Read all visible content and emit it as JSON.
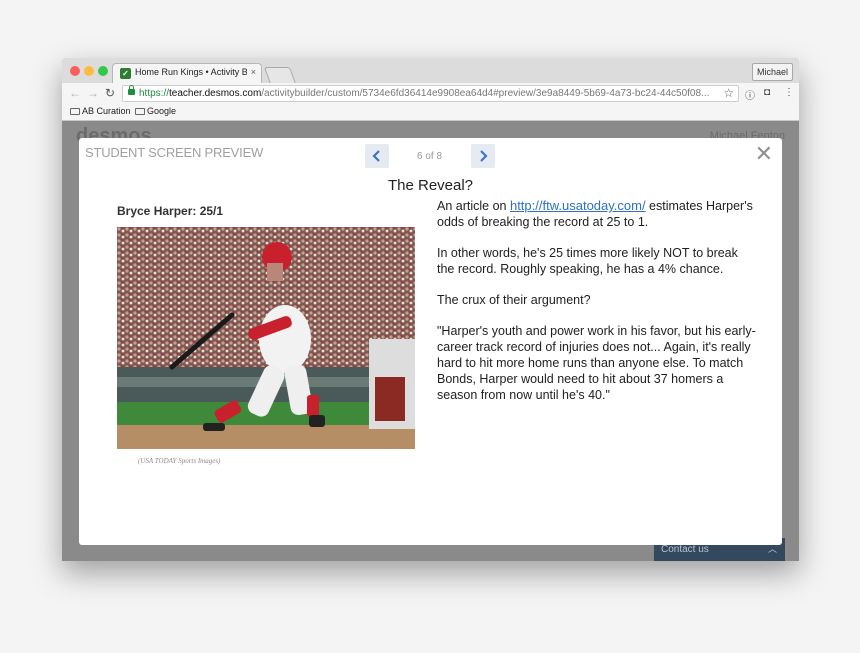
{
  "browser": {
    "tab_title": "Home Run Kings • Activity Buil",
    "tab_close_glyph": "×",
    "profile_label": "Michael",
    "url_scheme": "https://",
    "url_host": "teacher.desmos.com",
    "url_path": "/activitybuilder/custom/5734e6fd36414e9908ea64d4#preview/3e9a8449-5b69-4a73-bc24-44c50f08...",
    "bookmarks": [
      {
        "label": "AB Curation"
      },
      {
        "label": "Google"
      }
    ]
  },
  "page": {
    "logo_text": "desmos",
    "user_name": "Michael Fenton",
    "contact_label": "Contact us"
  },
  "modal": {
    "label": "STUDENT SCREEN PREVIEW",
    "pager_text": "6 of 8",
    "screen_title": "The Reveal?",
    "card_heading": "Bryce Harper: 25/1",
    "photo_caption": "(USA TODAY Sports Images)",
    "article": {
      "intro_before_link": "An article on ",
      "link_text": "http://ftw.usatoday.com/",
      "intro_after_link": " estimates Harper's odds of breaking the record at 25 to 1.",
      "para2": "In other words, he's 25 times more likely NOT to break the record. Roughly speaking, he has a 4% chance.",
      "para3": "The crux of their argument?",
      "para4": "\"Harper's youth and power work in his favor, but his early-career track record of injuries does not... Again, it's really hard to hit more home runs than anyone else. To match Bonds, Harper would need to hit about 37 homers a season from now until he's 40.\""
    }
  },
  "colors": {
    "traffic_red": "#fc605c",
    "traffic_yellow": "#fdbc40",
    "traffic_green": "#34c84a",
    "pager_arrow": "#3f74c1",
    "link": "#2f72c4",
    "contact_bg": "#34495e"
  }
}
